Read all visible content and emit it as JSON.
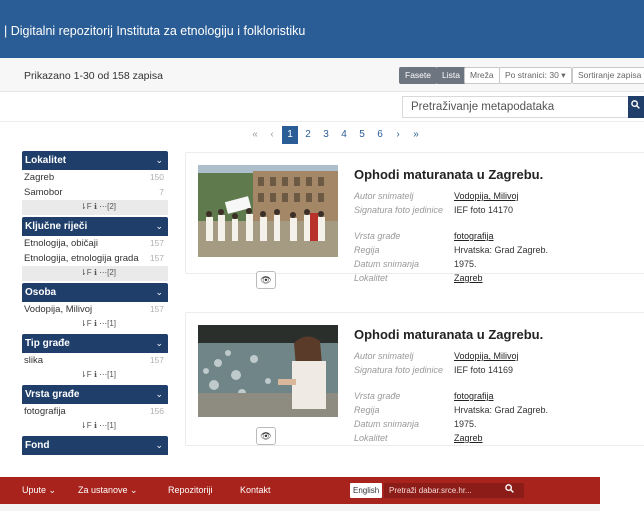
{
  "header": {
    "title": "| Digitalni repozitorij Instituta za etnologiju i folkloristiku"
  },
  "toolbar": {
    "results_text": "Prikazano 1-30 od 158 zapisa",
    "facets_label": "Fasete",
    "list_label": "Lista",
    "grid_label": "Mreža",
    "per_page_label": "Po stranici: 30 ▾",
    "sort_label": "Sortiranje zapisa ▾"
  },
  "search": {
    "placeholder": "Pretraživanje metapodataka",
    "button_icon": "search-icon"
  },
  "pagination": {
    "first": "«",
    "prev": "‹",
    "pages": [
      "1",
      "2",
      "3",
      "4",
      "5",
      "6"
    ],
    "current": "1",
    "next": "›",
    "last": "»"
  },
  "facets": [
    {
      "title": "Lokalitet",
      "items": [
        {
          "label": "Zagreb",
          "count": "150"
        },
        {
          "label": "Samobor",
          "count": "7"
        }
      ],
      "tools": "⇂F ℹ ⋯[2]"
    },
    {
      "title": "Ključne riječi",
      "items": [
        {
          "label": "Etnologija, običaji",
          "count": "157"
        },
        {
          "label": "Etnologija, etnologija grada",
          "count": "157"
        }
      ],
      "tools": "⇂F ℹ ⋯[2]"
    },
    {
      "title": "Osoba",
      "items": [
        {
          "label": "Vodopija, Milivoj",
          "count": "157"
        }
      ],
      "tools": "⇂F ℹ ⋯[1]"
    },
    {
      "title": "Tip građe",
      "items": [
        {
          "label": "slika",
          "count": "157"
        }
      ],
      "tools": "⇂F ℹ ⋯[1]"
    },
    {
      "title": "Vrsta građe",
      "items": [
        {
          "label": "fotografija",
          "count": "156"
        }
      ],
      "tools": "⇂F ℹ ⋯[1]"
    },
    {
      "title": "Fond",
      "items": [],
      "tools": ""
    }
  ],
  "facet_chevron": "⌄",
  "records": [
    {
      "title": "Ophodi maturanata u Zagrebu.",
      "image_icon": "parade-photo",
      "view_icon": "eye-icon",
      "fields": [
        {
          "label": "Autor snimatelj",
          "value": "Vodopija, Milivoj",
          "link": true
        },
        {
          "label": "Signatura foto jedinice",
          "value": "IEF foto 14170",
          "link": false
        },
        {
          "label": "Vrsta građe",
          "value": "fotografija",
          "link": true
        },
        {
          "label": "Regija",
          "value": "Hrvatska: Grad Zagreb.",
          "link": false
        },
        {
          "label": "Datum snimanja",
          "value": "1975.",
          "link": false
        },
        {
          "label": "Lokalitet",
          "value": "Zagreb",
          "link": true
        }
      ]
    },
    {
      "title": "Ophodi maturanata u Zagrebu.",
      "image_icon": "fountain-photo",
      "view_icon": "eye-icon",
      "fields": [
        {
          "label": "Autor snimatelj",
          "value": "Vodopija, Milivoj",
          "link": true
        },
        {
          "label": "Signatura foto jedinice",
          "value": "IEF foto 14169",
          "link": false
        },
        {
          "label": "Vrsta građe",
          "value": "fotografija",
          "link": true
        },
        {
          "label": "Regija",
          "value": "Hrvatska: Grad Zagreb.",
          "link": false
        },
        {
          "label": "Datum snimanja",
          "value": "1975.",
          "link": false
        },
        {
          "label": "Lokalitet",
          "value": "Zagreb",
          "link": true
        }
      ]
    }
  ],
  "footer": {
    "menu": [
      "Upute ⌄",
      "Za ustanove ⌄",
      "Repozitoriji",
      "Kontakt"
    ],
    "language": "English",
    "search_placeholder": "Pretraži dabar.srce.hr...",
    "search_icon": "search-icon"
  },
  "colors": {
    "header": "#2a5d95",
    "facet_header": "#1f3f6a",
    "footer": "#a8231c",
    "active_button": "#6d7580"
  }
}
